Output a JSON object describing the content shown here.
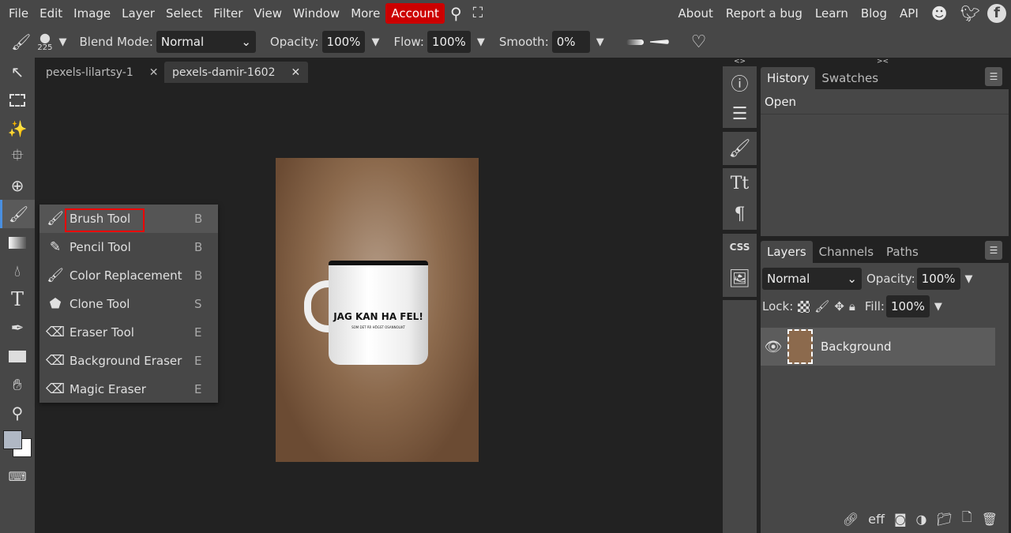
{
  "menu": [
    "File",
    "Edit",
    "Image",
    "Layer",
    "Select",
    "Filter",
    "View",
    "Window",
    "More"
  ],
  "account": "Account",
  "links": [
    "About",
    "Report a bug",
    "Learn",
    "Blog",
    "API"
  ],
  "options": {
    "brush_size": "225",
    "blend_label": "Blend Mode:",
    "blend_value": "Normal",
    "opacity_label": "Opacity:",
    "opacity": "100%",
    "flow_label": "Flow:",
    "flow": "100%",
    "smooth_label": "Smooth:",
    "smooth": "0%"
  },
  "tabs": [
    {
      "label": "pexels-lilartsy-1"
    },
    {
      "label": "pexels-damir-1602"
    }
  ],
  "photo": {
    "mug_text": "JAG KAN HA FEL!",
    "mug_subtext": "SOM DET ÄR HÖGST OSANNOLIKT"
  },
  "flyout": [
    {
      "label": "Brush Tool",
      "key": "B",
      "icon": "brush-icon"
    },
    {
      "label": "Pencil Tool",
      "key": "B",
      "icon": "pencil-icon"
    },
    {
      "label": "Color Replacement",
      "key": "B",
      "icon": "color-replace-icon"
    },
    {
      "label": "Clone Tool",
      "key": "S",
      "icon": "stamp-icon"
    },
    {
      "label": "Eraser Tool",
      "key": "E",
      "icon": "eraser-icon"
    },
    {
      "label": "Background Eraser",
      "key": "E",
      "icon": "bg-eraser-icon"
    },
    {
      "label": "Magic Eraser",
      "key": "E",
      "icon": "magic-eraser-icon"
    }
  ],
  "history": {
    "tabs": [
      "History",
      "Swatches"
    ],
    "items": [
      "Open"
    ]
  },
  "layers": {
    "tabs": [
      "Layers",
      "Channels",
      "Paths"
    ],
    "blend": "Normal",
    "opacity_label": "Opacity:",
    "opacity": "100%",
    "lock_label": "Lock:",
    "fill_label": "Fill:",
    "fill": "100%",
    "items": [
      {
        "name": "Background"
      }
    ]
  },
  "side_icons": {
    "css": "CSS"
  },
  "bottom": {
    "eff": "eff"
  },
  "colors": {
    "accent": "#cc0000",
    "highlight": "#e00000"
  }
}
